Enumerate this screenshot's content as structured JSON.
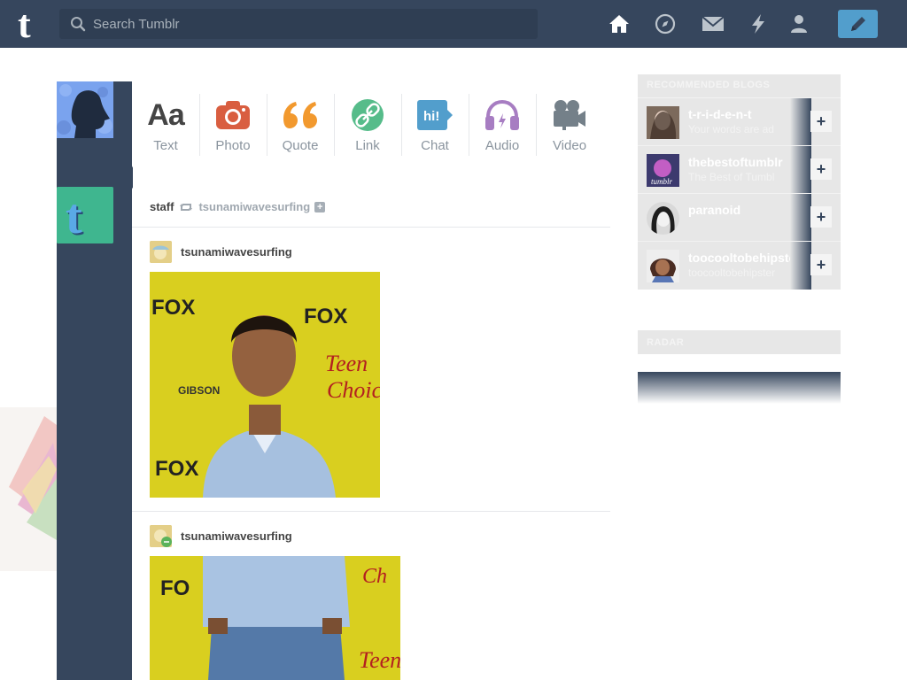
{
  "header": {
    "search_placeholder": "Search Tumblr",
    "nav": [
      "home-icon",
      "explore-icon",
      "inbox-icon",
      "activity-icon",
      "account-icon"
    ],
    "compose_icon": "pencil-icon",
    "colors": {
      "bar": "#36465d",
      "compose": "#529ecc"
    }
  },
  "post_types": [
    {
      "label": "Text",
      "icon": "text-icon",
      "color": "#444444"
    },
    {
      "label": "Photo",
      "icon": "camera-icon",
      "color": "#d95e40"
    },
    {
      "label": "Quote",
      "icon": "quote-icon",
      "color": "#f2992e"
    },
    {
      "label": "Link",
      "icon": "link-icon",
      "color": "#56bc8a"
    },
    {
      "label": "Chat",
      "icon": "chat-icon",
      "color": "#529ecc"
    },
    {
      "label": "Audio",
      "icon": "headphones-icon",
      "color": "#a77dc2"
    },
    {
      "label": "Video",
      "icon": "video-camera-icon",
      "color": "#748089"
    }
  ],
  "post": {
    "reblogger": "staff",
    "source": "tsunamiwavesurfing",
    "entries": [
      {
        "username": "tsunamiwavesurfing"
      },
      {
        "username": "tsunamiwavesurfing"
      }
    ]
  },
  "recommended": {
    "title": "RECOMMENDED BLOGS",
    "blogs": [
      {
        "name": "t-r-i-d-e-n-t",
        "tagline": "Your words are ad"
      },
      {
        "name": "thebestoftumblr",
        "tagline": "The Best of Tumbl"
      },
      {
        "name": "paranoid",
        "tagline": ""
      },
      {
        "name": "toocooltobehipster",
        "tagline": "toocooltobehipster"
      }
    ]
  },
  "radar": {
    "title": "RADAR"
  }
}
